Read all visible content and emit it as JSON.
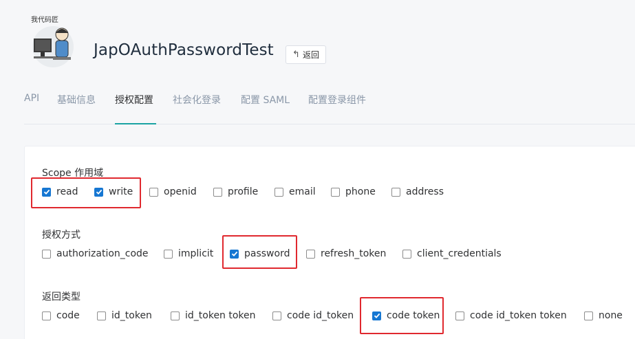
{
  "header": {
    "logo_text": "我代码匠",
    "app_title": "JapOAuthPasswordTest",
    "back_label": "返回"
  },
  "tabs": [
    {
      "label": "API"
    },
    {
      "label": "基础信息"
    },
    {
      "label": "授权配置"
    },
    {
      "label": "社会化登录"
    },
    {
      "label": "配置 SAML"
    },
    {
      "label": "配置登录组件"
    }
  ],
  "active_tab": "授权配置",
  "sections": {
    "scope": {
      "label": "Scope 作用域",
      "options": [
        {
          "label": "read",
          "checked": true
        },
        {
          "label": "write",
          "checked": true
        },
        {
          "label": "openid",
          "checked": false
        },
        {
          "label": "profile",
          "checked": false
        },
        {
          "label": "email",
          "checked": false
        },
        {
          "label": "phone",
          "checked": false
        },
        {
          "label": "address",
          "checked": false
        }
      ]
    },
    "grant_type": {
      "label": "授权方式",
      "options": [
        {
          "label": "authorization_code",
          "checked": false
        },
        {
          "label": "implicit",
          "checked": false
        },
        {
          "label": "password",
          "checked": true
        },
        {
          "label": "refresh_token",
          "checked": false
        },
        {
          "label": "client_credentials",
          "checked": false
        }
      ]
    },
    "response_type": {
      "label": "返回类型",
      "options": [
        {
          "label": "code",
          "checked": false
        },
        {
          "label": "id_token",
          "checked": false
        },
        {
          "label": "id_token token",
          "checked": false
        },
        {
          "label": "code id_token",
          "checked": false
        },
        {
          "label": "code token",
          "checked": true
        },
        {
          "label": "code id_token token",
          "checked": false
        },
        {
          "label": "none",
          "checked": false
        }
      ]
    }
  },
  "colors": {
    "checkbox_checked": "#1677d2",
    "highlight": "#e0282e",
    "tab_ink": "#1aa3a3"
  }
}
